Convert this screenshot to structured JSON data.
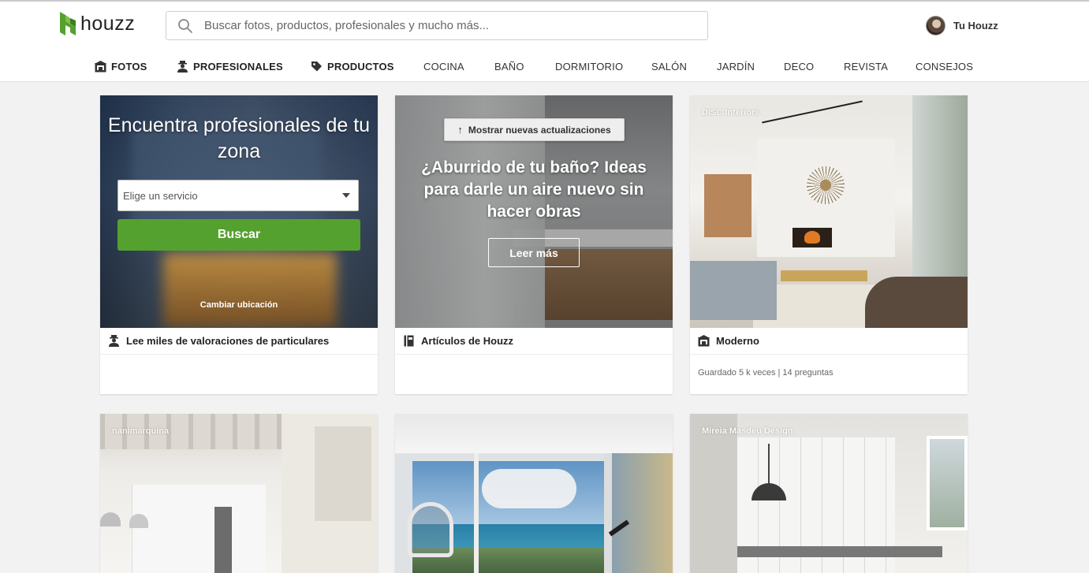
{
  "app": {
    "logo_text": "houzz",
    "brand_color": "#55a12f"
  },
  "search": {
    "placeholder": "Buscar fotos, productos, profesionales y mucho más..."
  },
  "user": {
    "label": "Tu Houzz"
  },
  "nav": {
    "items": [
      {
        "label": "FOTOS",
        "icon": "photo-icon",
        "bold": true
      },
      {
        "label": "PROFESIONALES",
        "icon": "professional-icon",
        "bold": true
      },
      {
        "label": "PRODUCTOS",
        "icon": "tag-icon",
        "bold": true
      },
      {
        "label": "COCINA"
      },
      {
        "label": "BAÑO"
      },
      {
        "label": "DORMITORIO"
      },
      {
        "label": "SALÓN"
      },
      {
        "label": "JARDÍN"
      },
      {
        "label": "DECO"
      },
      {
        "label": "REVISTA"
      },
      {
        "label": "CONSEJOS"
      }
    ]
  },
  "cards": {
    "pro": {
      "title": "Encuentra profesionales de tu zona",
      "select_placeholder": "Elige un servicio",
      "button": "Buscar",
      "location_link": "Cambiar ubicación",
      "footer": "Lee miles de valoraciones de particulares"
    },
    "bath": {
      "update_pill": "Mostrar nuevas actualizaciones",
      "title": "¿Aburrido de tu baño? Ideas para darle un aire nuevo sin hacer obras",
      "button": "Leer más",
      "footer": "Artículos de Houzz"
    },
    "living": {
      "credit": "DISC Interiors",
      "footer": "Moderno",
      "meta": "Guardado 5 k veces | 14 preguntas"
    },
    "kitchen1": {
      "credit": "nanimarquina"
    },
    "view": {
      "credit": ""
    },
    "kitchen2": {
      "credit": "Mireia Masdeu Design"
    }
  }
}
